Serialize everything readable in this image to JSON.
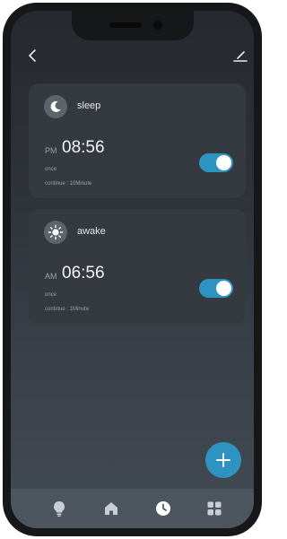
{
  "alarms": [
    {
      "icon": "moon-icon",
      "title": "sleep",
      "period": "PM",
      "time": "08:56",
      "repeat": "once",
      "continue": "continue : 10Minute",
      "enabled": true
    },
    {
      "icon": "sun-icon",
      "title": "awake",
      "period": "AM",
      "time": "06:56",
      "repeat": "once",
      "continue": "continue : 1Minute",
      "enabled": true
    }
  ],
  "header": {
    "back_icon": "chevron-left-icon",
    "edit_icon": "edit-pen-icon"
  },
  "fab": {
    "icon": "plus-icon"
  },
  "bottom_nav": {
    "items": [
      {
        "icon": "lightbulb-icon",
        "active": false
      },
      {
        "icon": "home-icon",
        "active": false
      },
      {
        "icon": "clock-icon",
        "active": true
      },
      {
        "icon": "grid-icon",
        "active": false
      }
    ]
  },
  "colors": {
    "accent": "#2f93c2",
    "card": "#353a41",
    "nav_bar": "#4d555e",
    "nav_icon": "#c9ced4",
    "active_icon": "#ffffff"
  }
}
